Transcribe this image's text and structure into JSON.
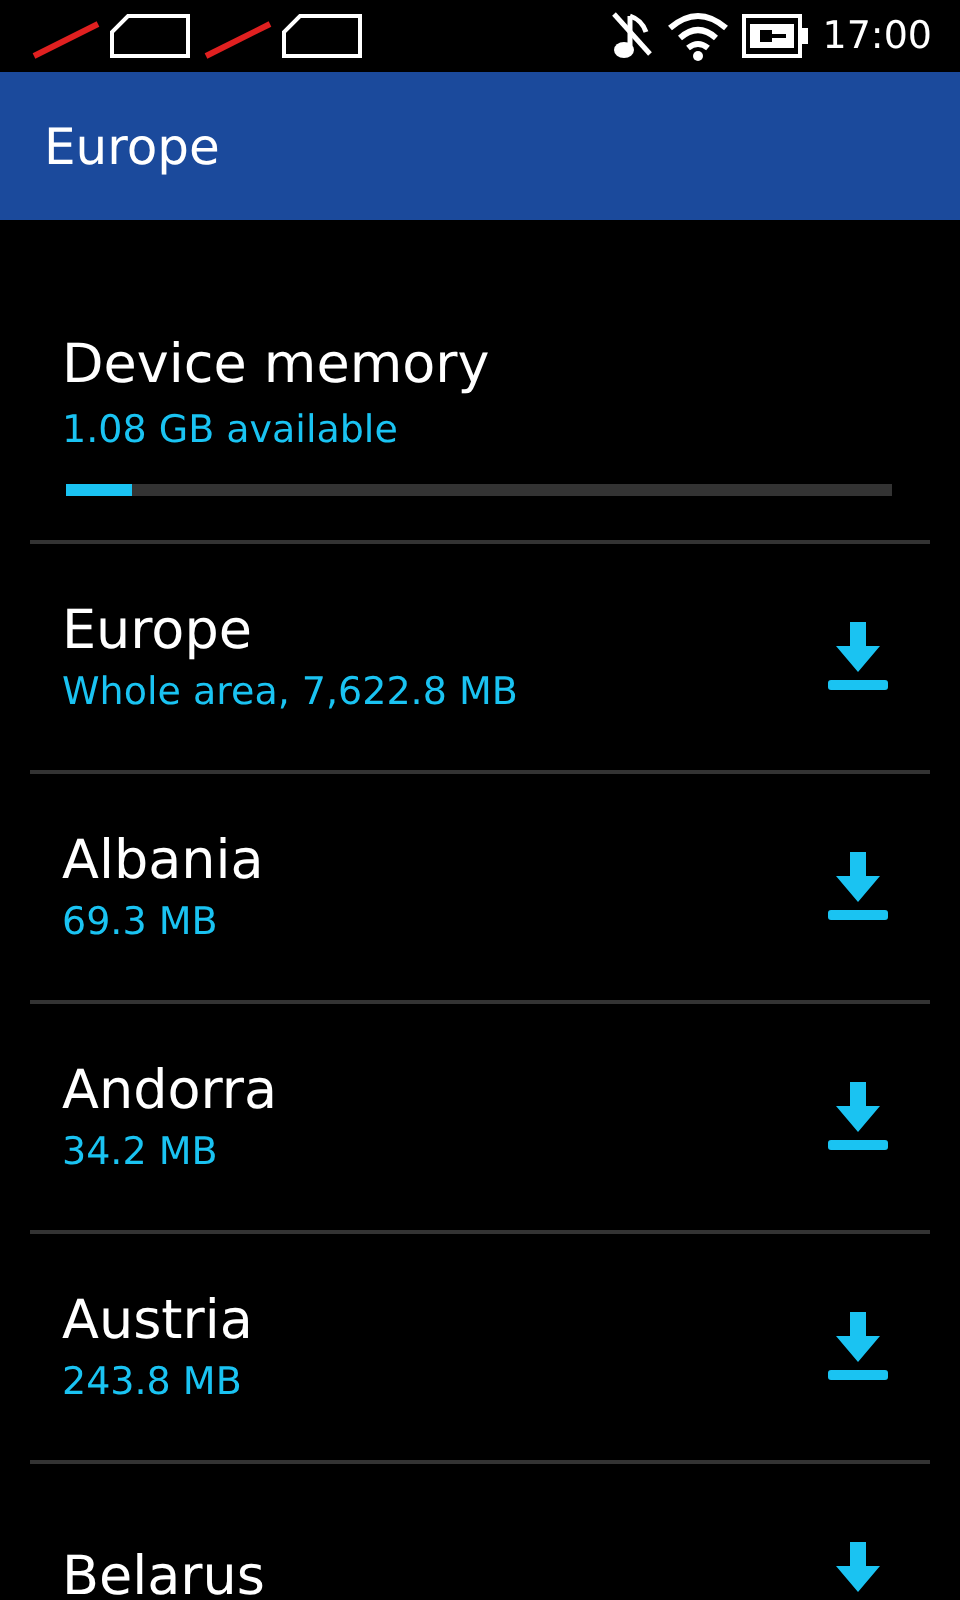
{
  "status_bar": {
    "time": "17:00"
  },
  "header": {
    "title": "Europe"
  },
  "memory": {
    "title": "Device memory",
    "available": "1.08 GB available",
    "level": 0.08
  },
  "regions": [
    {
      "name": "Europe",
      "size": "Whole area, 7,622.8 MB"
    },
    {
      "name": "Albania",
      "size": "69.3 MB"
    },
    {
      "name": "Andorra",
      "size": "34.2 MB"
    },
    {
      "name": "Austria",
      "size": "243.8 MB"
    },
    {
      "name": "Belarus"
    }
  ]
}
